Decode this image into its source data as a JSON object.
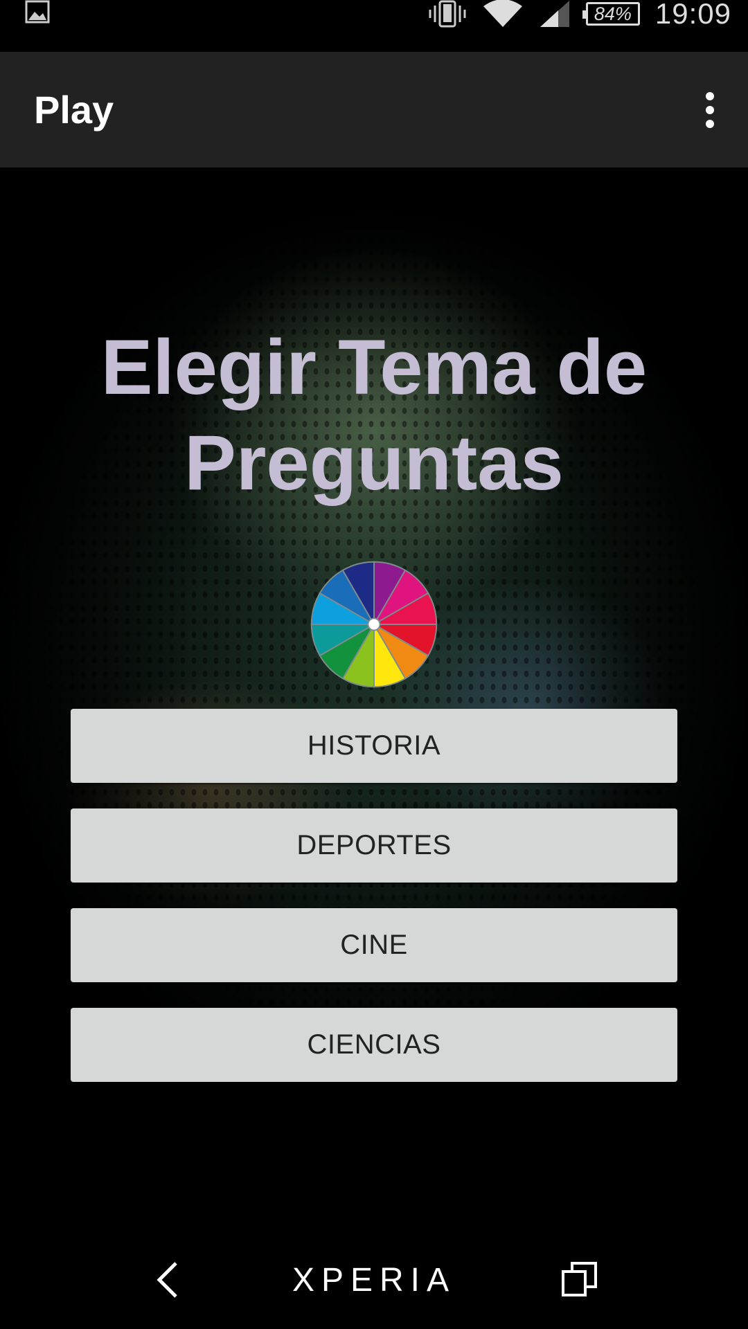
{
  "status_bar": {
    "battery": "84%",
    "time": "19:09",
    "icons": [
      "gallery-icon",
      "vibrate-icon",
      "wifi-icon",
      "signal-icon",
      "battery-icon"
    ]
  },
  "app_bar": {
    "title": "Play",
    "menu_icon": "overflow-menu-icon"
  },
  "main": {
    "heading": "Elegir Tema de Preguntas",
    "logo_icon": "color-wheel-icon",
    "topics": [
      "HISTORIA",
      "DEPORTES",
      "CINE",
      "CIENCIAS"
    ]
  },
  "nav_bar": {
    "brand": "XPERIA",
    "icons": [
      "back-icon",
      "recents-icon"
    ]
  },
  "colors": {
    "app_bar_bg": "#222222",
    "heading_text": "#c4bdd3",
    "button_bg": "#d6d7d7",
    "button_text": "#222222"
  }
}
